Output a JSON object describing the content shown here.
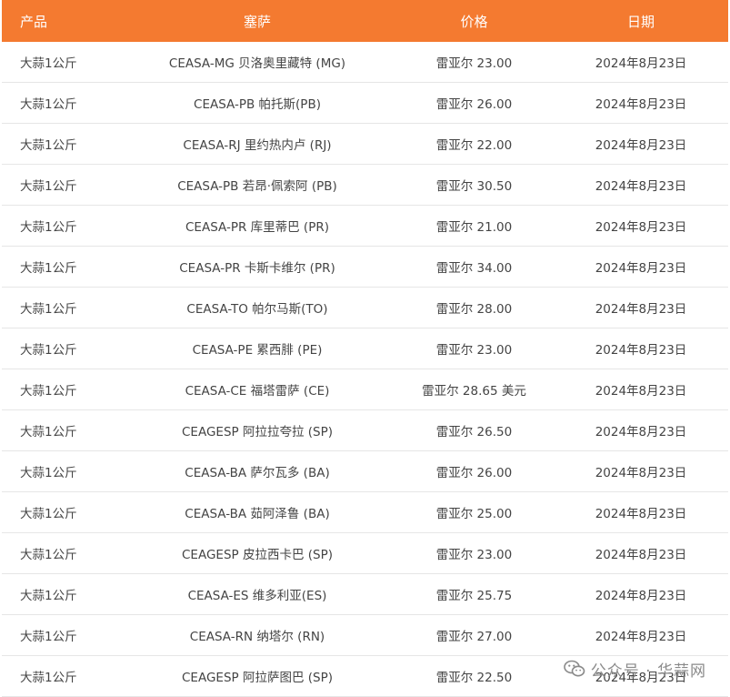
{
  "table": {
    "headers": [
      "产品",
      "塞萨",
      "价格",
      "日期"
    ],
    "rows": [
      [
        "大蒜1公斤",
        "CEASA-MG 贝洛奥里藏特 (MG)",
        "雷亚尔 23.00",
        "2024年8月23日"
      ],
      [
        "大蒜1公斤",
        "CEASA-PB 帕托斯(PB)",
        "雷亚尔 26.00",
        "2024年8月23日"
      ],
      [
        "大蒜1公斤",
        "CEASA-RJ 里约热内卢 (RJ)",
        "雷亚尔 22.00",
        "2024年8月23日"
      ],
      [
        "大蒜1公斤",
        "CEASA-PB 若昂·佩索阿 (PB)",
        "雷亚尔 30.50",
        "2024年8月23日"
      ],
      [
        "大蒜1公斤",
        "CEASA-PR 库里蒂巴 (PR)",
        "雷亚尔 21.00",
        "2024年8月23日"
      ],
      [
        "大蒜1公斤",
        "CEASA-PR 卡斯卡维尔 (PR)",
        "雷亚尔 34.00",
        "2024年8月23日"
      ],
      [
        "大蒜1公斤",
        "CEASA-TO 帕尔马斯(TO)",
        "雷亚尔 28.00",
        "2024年8月23日"
      ],
      [
        "大蒜1公斤",
        "CEASA-PE 累西腓 (PE)",
        "雷亚尔 23.00",
        "2024年8月23日"
      ],
      [
        "大蒜1公斤",
        "CEASA-CE 福塔雷萨 (CE)",
        "雷亚尔 28.65 美元",
        "2024年8月23日"
      ],
      [
        "大蒜1公斤",
        "CEAGESP 阿拉拉夸拉 (SP)",
        "雷亚尔 26.50",
        "2024年8月23日"
      ],
      [
        "大蒜1公斤",
        "CEASA-BA 萨尔瓦多 (BA)",
        "雷亚尔 26.00",
        "2024年8月23日"
      ],
      [
        "大蒜1公斤",
        "CEASA-BA 茹阿泽鲁 (BA)",
        "雷亚尔 25.00",
        "2024年8月23日"
      ],
      [
        "大蒜1公斤",
        "CEAGESP 皮拉西卡巴 (SP)",
        "雷亚尔 23.00",
        "2024年8月23日"
      ],
      [
        "大蒜1公斤",
        "CEASA-ES 维多利亚(ES)",
        "雷亚尔 25.75",
        "2024年8月23日"
      ],
      [
        "大蒜1公斤",
        "CEASA-RN 纳塔尔 (RN)",
        "雷亚尔 27.00",
        "2024年8月23日"
      ],
      [
        "大蒜1公斤",
        "CEAGESP 阿拉萨图巴 (SP)",
        "雷亚尔 22.50",
        "2024年8月23日"
      ]
    ]
  },
  "watermark": {
    "text": "公众号 · 华蒜网",
    "icon": "wechat-icon"
  },
  "colors": {
    "header_bg": "#f47a30",
    "header_text": "#ffffff",
    "row_text": "#444444",
    "row_border": "#e6e6e6"
  }
}
